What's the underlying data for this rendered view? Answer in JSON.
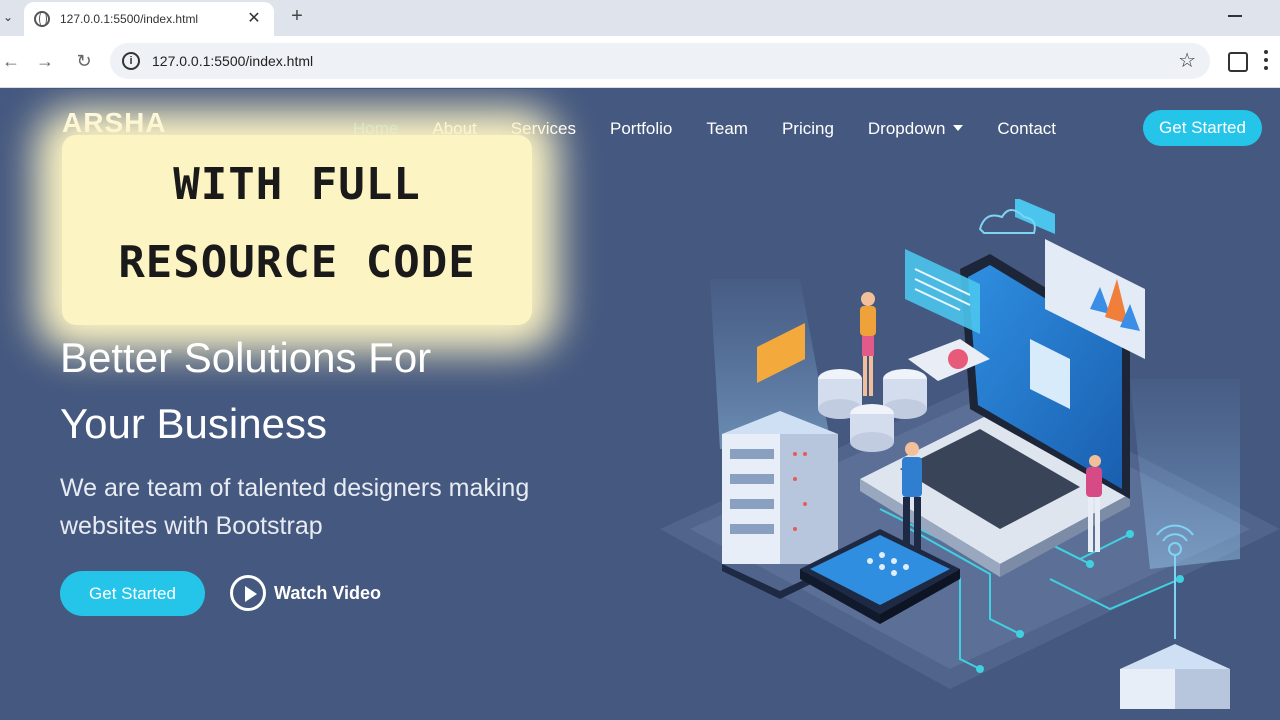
{
  "browser": {
    "tab_title": "127.0.0.1:5500/index.html",
    "tab_close": "✕",
    "new_tab": "+",
    "url": "127.0.0.1:5500/index.html",
    "back": "←",
    "forward": "→",
    "reload": "↻",
    "info": "i",
    "star": "☆",
    "tab_menu": "⌄"
  },
  "site": {
    "logo": "ARSHA",
    "nav": [
      {
        "label": "Home",
        "active": true
      },
      {
        "label": "About"
      },
      {
        "label": "Services"
      },
      {
        "label": "Portfolio"
      },
      {
        "label": "Team"
      },
      {
        "label": "Pricing"
      },
      {
        "label": "Dropdown"
      },
      {
        "label": "Contact"
      }
    ],
    "nav_cta": "Get Started"
  },
  "overlay": {
    "line1": "WITH FULL",
    "line2": "RESOURCE CODE"
  },
  "hero": {
    "title_line1": "Better Solutions For",
    "title_line2": "Your Business",
    "subtitle_line1": "We are team of talented designers making",
    "subtitle_line2": "websites with Bootstrap",
    "cta": "Get Started",
    "watch": "Watch Video"
  },
  "colors": {
    "page_bg": "#45587f",
    "accent": "#25c5ea",
    "active_nav": "#47b2e4",
    "overlay_bg": "#fdf4c4"
  }
}
